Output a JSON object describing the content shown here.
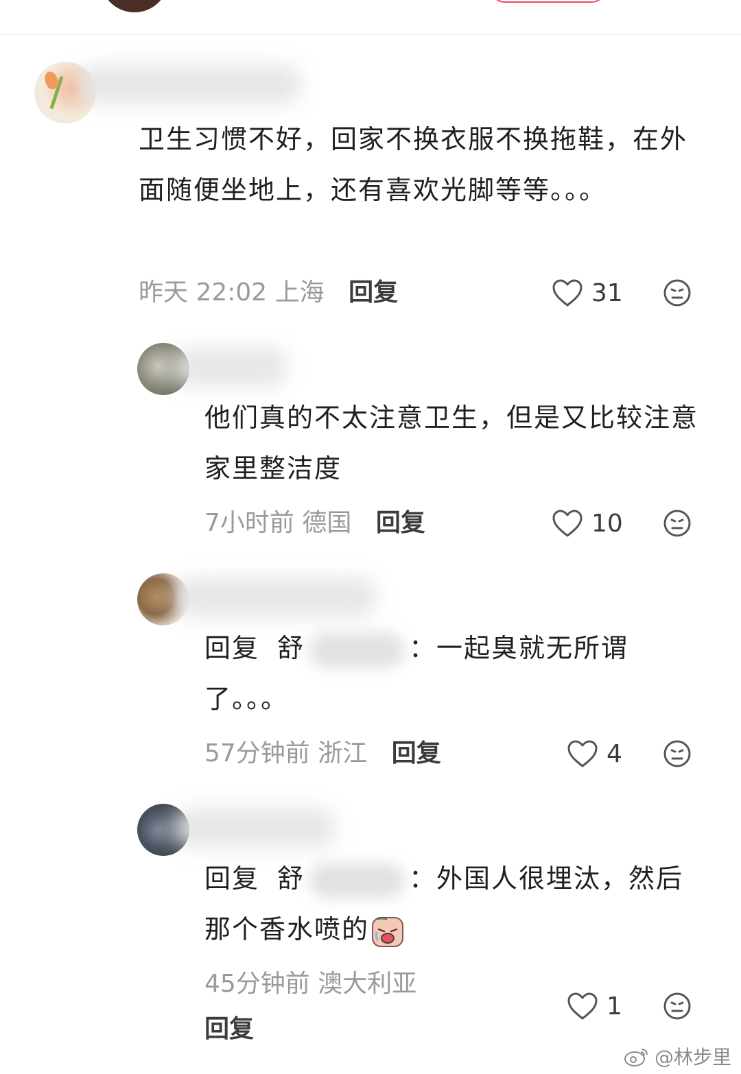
{
  "comments": [
    {
      "text": "卫生习惯不好，回家不换衣服不换拖鞋，在外面随便坐地上，还有喜欢光脚等等。。。",
      "time": "昨天 22:02",
      "location": "上海",
      "reply_label": "回复",
      "likes": "31"
    }
  ],
  "replies": [
    {
      "text": "他们真的不太注意卫生，但是又比较注意家里整洁度",
      "time": "7小时前",
      "location": "德国",
      "reply_label": "回复",
      "likes": "10"
    },
    {
      "prefix": "回复",
      "mention_visible": "舒",
      "separator": "：",
      "text": "一起臭就无所谓了。。。",
      "time": "57分钟前",
      "location": "浙江",
      "reply_label": "回复",
      "likes": "4"
    },
    {
      "prefix": "回复",
      "mention_visible": "舒",
      "separator": "：",
      "text": "外国人很埋汰，然后那个香水喷的",
      "time": "45分钟前",
      "location": "澳大利亚",
      "reply_label": "回复",
      "likes": "1"
    }
  ],
  "icons": {
    "like": "heart-outline-icon",
    "emoji": "neutral-face-icon",
    "sticker": "crying-sticker-icon",
    "watermark": "weibo-logo-icon"
  },
  "colors": {
    "meta_gray": "#9a9a9a",
    "text": "#1f1f1f",
    "follow_pink": "#f24868"
  },
  "watermark": {
    "text": "@林步里"
  }
}
